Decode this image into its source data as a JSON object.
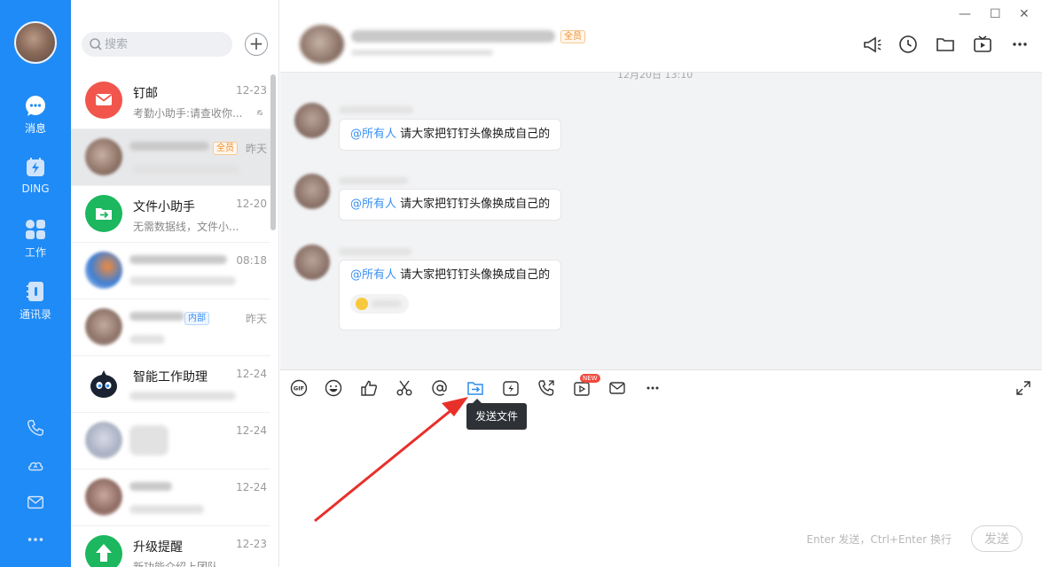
{
  "nav": {
    "items": [
      {
        "label": "消息",
        "icon": "chat-bubble-icon"
      },
      {
        "label": "DING",
        "icon": "ding-lightning-icon"
      },
      {
        "label": "工作",
        "icon": "apps-grid-icon"
      },
      {
        "label": "通讯录",
        "icon": "contacts-book-icon"
      }
    ],
    "bottom_icons": [
      "phone-icon",
      "cloud-icon",
      "mail-icon",
      "more-dots-icon"
    ]
  },
  "search": {
    "placeholder": "搜索"
  },
  "conversations": [
    {
      "name": "钉邮",
      "time": "12-23",
      "preview": "考勤小助手:请查收你..."
    },
    {
      "name": "",
      "time": "昨天",
      "preview": "",
      "tag": "全员"
    },
    {
      "name": "文件小助手",
      "time": "12-20",
      "preview": "无需数据线，文件小..."
    },
    {
      "name": "",
      "time": "08:18",
      "preview": ""
    },
    {
      "name": "",
      "time": "昨天",
      "preview": "",
      "tag": "内部"
    },
    {
      "name": "智能工作助理",
      "time": "12-24",
      "preview": ""
    },
    {
      "name": "",
      "time": "12-24",
      "preview": ""
    },
    {
      "name": "",
      "time": "12-24",
      "preview": ""
    },
    {
      "name": "升级提醒",
      "time": "12-23",
      "preview": "新功能介绍上团队"
    }
  ],
  "chat": {
    "title_tag": "全员",
    "date_divider": "12月20日 13:10",
    "messages": [
      {
        "mention": "@所有人",
        "text": " 请大家把钉钉头像换成自己的"
      },
      {
        "mention": "@所有人",
        "text": " 请大家把钉钉头像换成自己的"
      },
      {
        "mention": "@所有人",
        "text": " 请大家把钉钉头像换成自己的"
      }
    ],
    "toolbar_icons": [
      "gif-icon",
      "emoji-icon",
      "thumbs-up-icon",
      "scissors-icon",
      "at-sign-icon",
      "send-file-icon",
      "ding-icon",
      "phone-call-icon",
      "video-icon",
      "mail-icon",
      "more-dots-icon"
    ],
    "new_badge": "NEW",
    "tooltip": "发送文件",
    "input_hint": "Enter 发送，Ctrl+Enter 换行",
    "send_label": "发送"
  },
  "colors": {
    "nav_bg": "#1f8bf6",
    "accent": "#3a8ff5",
    "annotation_arrow": "#e8302a"
  }
}
